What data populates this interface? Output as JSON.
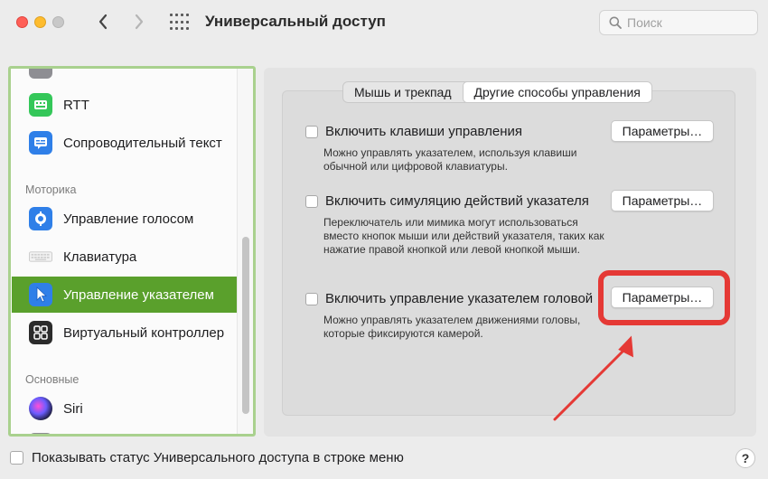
{
  "window": {
    "title": "Универсальный доступ",
    "search_placeholder": "Поиск"
  },
  "sidebar": {
    "items_top": [
      {
        "label": "RTT",
        "icon": "rtt-icon",
        "color": "#34c759"
      },
      {
        "label": "Сопроводительный текст",
        "icon": "captions-icon",
        "color": "#2f7fe8"
      }
    ],
    "section_motor": "Моторика",
    "items_motor": [
      {
        "label": "Управление голосом",
        "icon": "voice-control-icon",
        "color": "#2f7fe8"
      },
      {
        "label": "Клавиатура",
        "icon": "keyboard-icon",
        "color": "#e6e6e6"
      },
      {
        "label": "Управление указателем",
        "icon": "pointer-icon",
        "color": "#2f7fe8",
        "selected": true
      },
      {
        "label": "Виртуальный контроллер",
        "icon": "switch-control-icon",
        "color": "#2b2b2b"
      }
    ],
    "section_general": "Основные",
    "items_general": [
      {
        "label": "Siri",
        "icon": "siri-icon"
      }
    ]
  },
  "tabs": [
    {
      "label": "Мышь и трекпад",
      "active": false
    },
    {
      "label": "Другие способы управления",
      "active": true
    }
  ],
  "options": [
    {
      "label": "Включить клавиши управления",
      "checked": false,
      "description": "Можно управлять указателем, используя клавиши обычной или цифровой клавиатуры.",
      "button": "Параметры…"
    },
    {
      "label": "Включить симуляцию действий указателя",
      "checked": false,
      "description": "Переключатель или мимика могут использоваться вместо кнопок мыши или действий указателя, таких как нажатие правой кнопкой или левой кнопкой мыши.",
      "button": "Параметры…"
    },
    {
      "label": "Включить управление указателем головой",
      "checked": false,
      "description": "Можно управлять указателем движениями головы, которые фиксируются камерой.",
      "button": "Параметры…"
    }
  ],
  "footer": {
    "show_status_label": "Показывать статус Универсального доступа в строке меню",
    "show_status_checked": false,
    "help_label": "?"
  },
  "colors": {
    "selection": "#5aa02c",
    "sidebar_border": "#a9d18e",
    "annotation": "#e53935"
  }
}
